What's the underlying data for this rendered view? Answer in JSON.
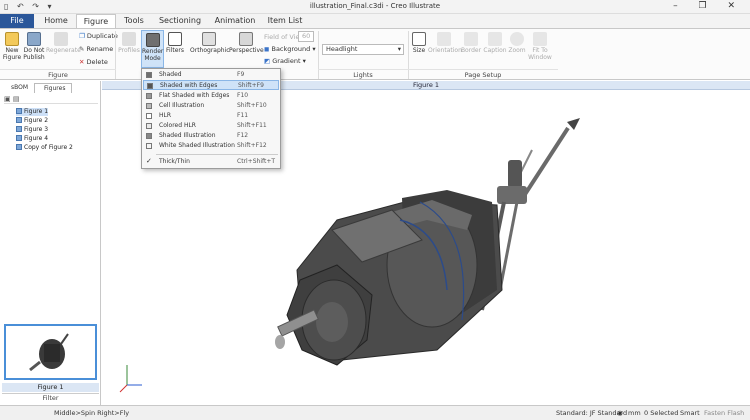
{
  "window": {
    "title": "illustration_Final.c3di - Creo Illustrate",
    "quick_access": "▯ ↶ ↷ ▾",
    "controls": "– ❐ ✕"
  },
  "tabs": [
    "File",
    "Home",
    "Figure",
    "Tools",
    "Sectioning",
    "Animation",
    "Item List"
  ],
  "ribbon": {
    "new_figure": "New Figure",
    "do_not_publish": "Do Not Publish",
    "regenerate": "Regenerate",
    "duplicate": "Duplicate",
    "rename": "Rename",
    "delete": "Delete",
    "profiles": "Profiles",
    "render_mode": "Render Mode",
    "filters": "Filters",
    "orthographic": "Orthographic",
    "perspective": "Perspective",
    "field_of_view_label": "Field of View",
    "field_of_view_value": "60",
    "background": "Background",
    "gradient": "Gradient",
    "lights_value": "Headlight",
    "size": "Size",
    "orientation": "Orientation",
    "border": "Border",
    "caption": "Caption",
    "zoom": "Zoom",
    "fit_to_window": "Fit To Window",
    "groups": {
      "figure": "Figure",
      "lights": "Lights",
      "page_setup": "Page Setup"
    }
  },
  "render_menu": [
    {
      "label": "Shaded",
      "shortcut": "F9"
    },
    {
      "label": "Shaded with Edges",
      "shortcut": "Shift+F9",
      "highlighted": true
    },
    {
      "label": "Flat Shaded with Edges",
      "shortcut": "F10"
    },
    {
      "label": "Cell Illustration",
      "shortcut": "Shift+F10"
    },
    {
      "label": "HLR",
      "shortcut": "F11"
    },
    {
      "label": "Colored HLR",
      "shortcut": "Shift+F11"
    },
    {
      "label": "Shaded Illustration",
      "shortcut": "F12"
    },
    {
      "label": "White Shaded Illustration",
      "shortcut": "Shift+F12"
    },
    {
      "label": "Thick/Thin",
      "shortcut": "Ctrl+Shift+T"
    }
  ],
  "panel": {
    "tabs": [
      "sBOM",
      "Figures"
    ],
    "figures": [
      "Figure 1",
      "Figure 2",
      "Figure 3",
      "Figure 4",
      "Copy of Figure 2"
    ],
    "thumbnail_caption": "Figure 1",
    "filter_label": "Filter"
  },
  "viewport": {
    "header": "Figure 1"
  },
  "status": {
    "mouse_hint": "Middle>Spin  Right>Fly",
    "standard": "Standard: JF Standard",
    "units": "mm",
    "selected": "0 Selected",
    "smart": "Smart",
    "extra": "Fasten    Flash"
  },
  "colors": {
    "file_tab": "#2b579a",
    "highlight": "#cfe3f8",
    "viewport_header": "#dbe6f4"
  }
}
